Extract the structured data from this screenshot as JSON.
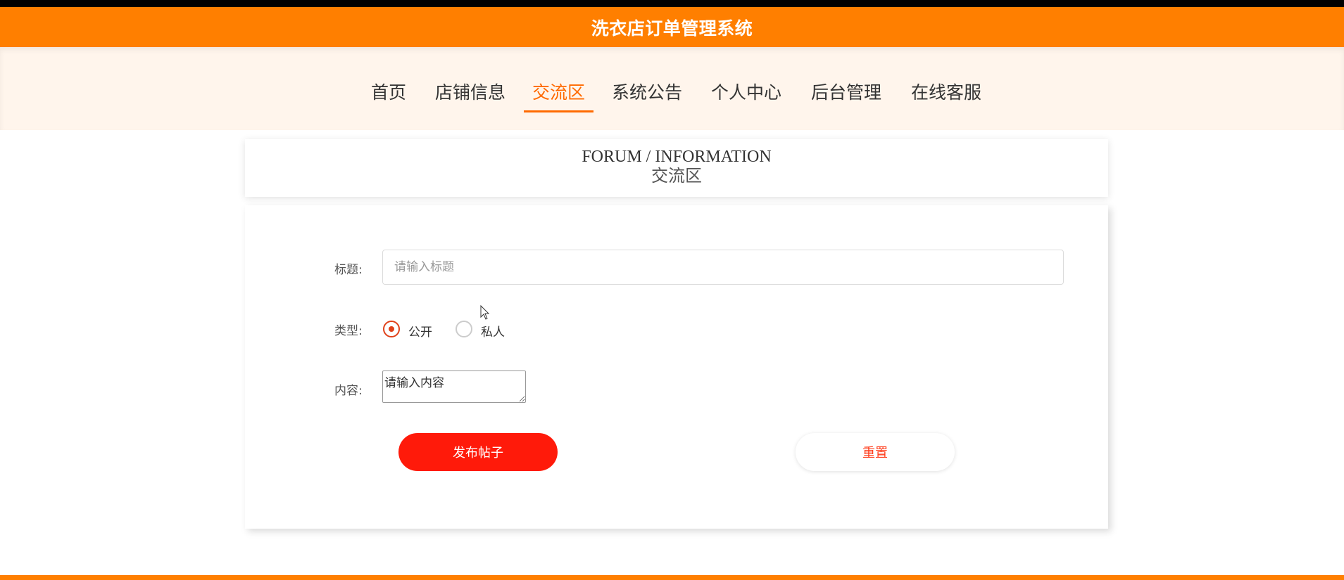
{
  "app": {
    "title": "洗衣店订单管理系统"
  },
  "nav": {
    "items": [
      {
        "label": "首页",
        "active": false
      },
      {
        "label": "店铺信息",
        "active": false
      },
      {
        "label": "交流区",
        "active": true
      },
      {
        "label": "系统公告",
        "active": false
      },
      {
        "label": "个人中心",
        "active": false
      },
      {
        "label": "后台管理",
        "active": false
      },
      {
        "label": "在线客服",
        "active": false
      }
    ]
  },
  "section": {
    "title_en": "FORUM / INFORMATION",
    "title_cn": "交流区"
  },
  "form": {
    "title_label": "标题:",
    "title_placeholder": "请输入标题",
    "title_value": "",
    "type_label": "类型:",
    "type_options": [
      {
        "label": "公开",
        "checked": true
      },
      {
        "label": "私人",
        "checked": false
      }
    ],
    "content_label": "内容:",
    "content_placeholder": "请输入内容",
    "publish_label": "发布帖子",
    "reset_label": "重置"
  },
  "colors": {
    "header_bg": "#ff7f00",
    "nav_bg": "#fff5ec",
    "accent": "#ff6a00",
    "publish_button": "#ff1a0a",
    "radio_checked": "#e0411a"
  }
}
